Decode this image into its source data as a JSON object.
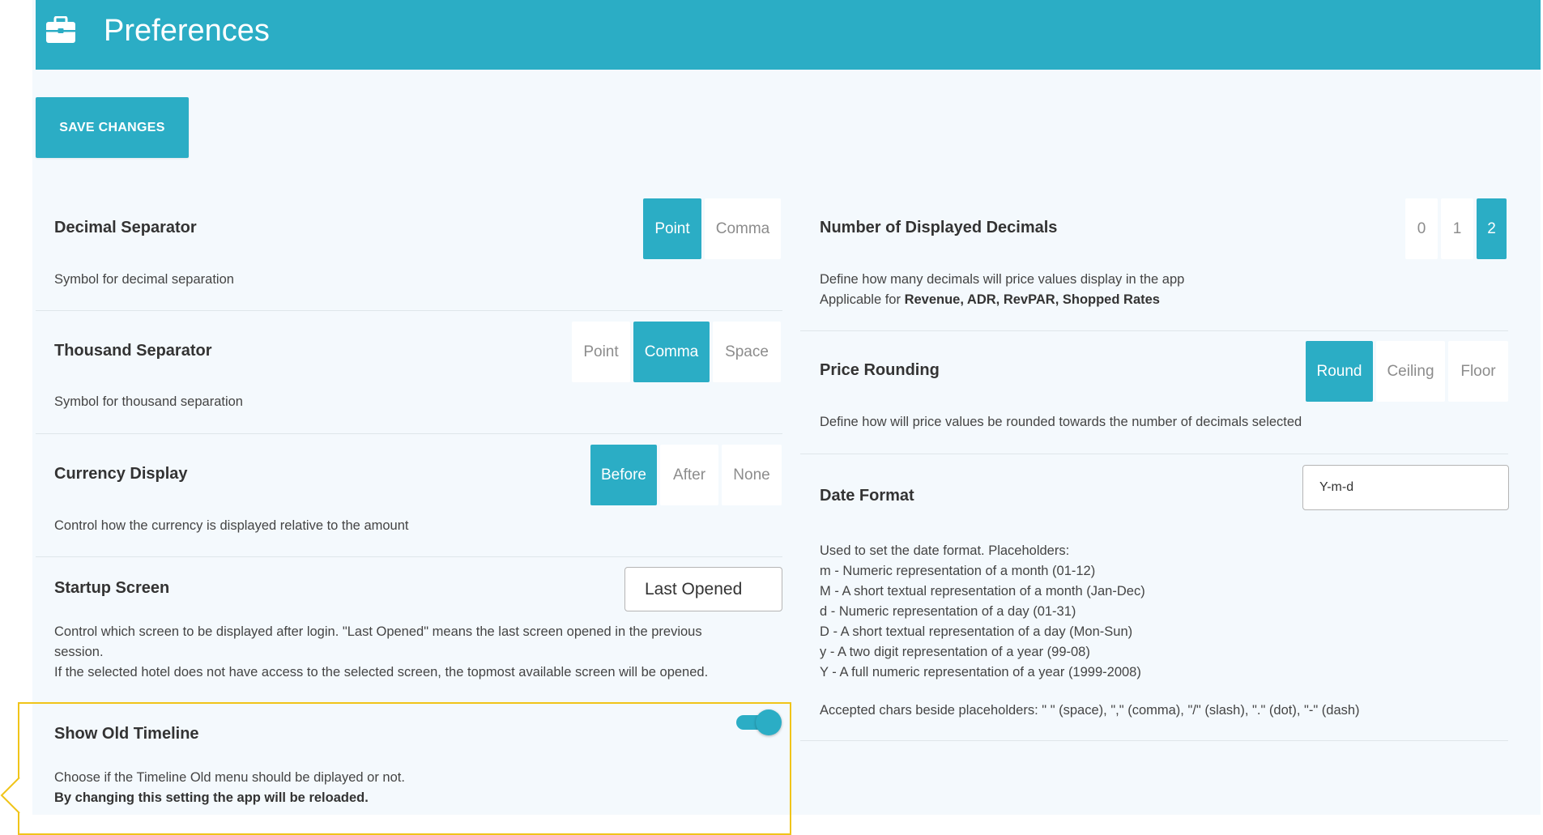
{
  "header": {
    "title": "Preferences",
    "icon": "briefcase-icon",
    "color": "#2badc5"
  },
  "toolbar": {
    "save_label": "SAVE CHANGES"
  },
  "left": {
    "decimal_separator": {
      "name": "Decimal Separator",
      "description": "Symbol for decimal separation",
      "options": [
        "Point",
        "Comma"
      ],
      "selected": "Point"
    },
    "thousand_separator": {
      "name": "Thousand Separator",
      "description": "Symbol for thousand separation",
      "options": [
        "Point",
        "Comma",
        "Space"
      ],
      "selected": "Comma"
    },
    "currency_display": {
      "name": "Currency Display",
      "description": "Control how the currency is displayed relative to the amount",
      "options": [
        "Before",
        "After",
        "None"
      ],
      "selected": "Before"
    },
    "startup_screen": {
      "name": "Startup Screen",
      "value": "Last Opened",
      "description_line1": "Control which screen to be displayed after login. \"Last Opened\" means the last screen opened in the previous",
      "description_line2": "session.",
      "description_line3": "If the selected hotel does not have access to the selected screen, the topmost available screen will be opened."
    },
    "show_old_timeline": {
      "name": "Show Old Timeline",
      "enabled": true,
      "description": "Choose if the Timeline Old menu should be diplayed or not.",
      "warning": "By changing this setting the app will be reloaded."
    }
  },
  "right": {
    "displayed_decimals": {
      "name": "Number of Displayed Decimals",
      "description_line1": "Define how many decimals will price values display in the app",
      "applicable_prefix": "Applicable for ",
      "applicable_items": "Revenue, ADR, RevPAR, Shopped Rates",
      "options": [
        "0",
        "1",
        "2"
      ],
      "selected": "2"
    },
    "price_rounding": {
      "name": "Price Rounding",
      "description": "Define how will price values be rounded towards the number of decimals selected",
      "options": [
        "Round",
        "Ceiling",
        "Floor"
      ],
      "selected": "Round"
    },
    "date_format": {
      "name": "Date Format",
      "value": "Y-m-d",
      "help": [
        "Used to set the date format. Placeholders:",
        "m - Numeric representation of a month (01-12)",
        "M - A short textual representation of a month (Jan-Dec)",
        "d - Numeric representation of a day (01-31)",
        "D - A short textual representation of a day (Mon-Sun)",
        "y - A two digit representation of a year (99-08)",
        "Y - A full numeric representation of a year (1999-2008)"
      ],
      "accepted_chars": "Accepted chars beside placeholders: \" \" (space), \",\" (comma), \"/\" (slash), \".\" (dot), \"-\" (dash)"
    }
  },
  "colors": {
    "accent": "#2badc5",
    "highlight": "#f0c419"
  }
}
